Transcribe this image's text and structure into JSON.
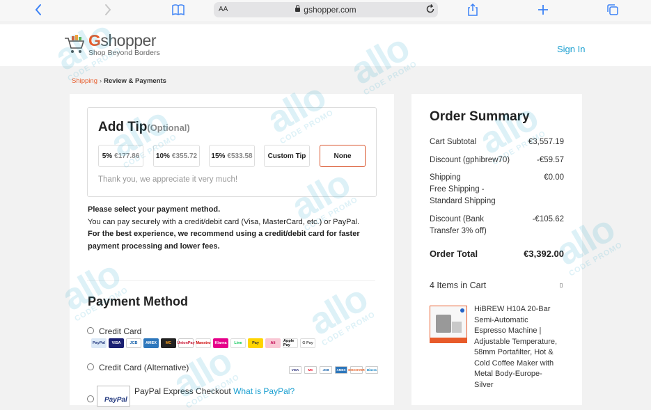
{
  "browser": {
    "text_size_label": "AA",
    "url": "gshopper.com",
    "back_icon": "chevron-left-icon",
    "forward_icon": "chevron-right-icon",
    "bookmarks_icon": "book-icon",
    "share_icon": "share-icon",
    "new_tab_icon": "plus-icon",
    "tabs_icon": "tabs-icon",
    "accent": "#3c82f6"
  },
  "header": {
    "brand": "Gshopper",
    "tagline": "Shop Beyond Borders",
    "sign_in": "Sign In",
    "brand_color": "#e85b2a",
    "link_color": "#1a9fd0"
  },
  "breadcrumb": {
    "step1": "Shipping",
    "separator": "›",
    "step2": "Review & Payments"
  },
  "tip": {
    "title": "Add Tip",
    "optional": "(Optional)",
    "options": [
      {
        "pct": "5%",
        "amount": "€177.86"
      },
      {
        "pct": "10%",
        "amount": "€355.72"
      },
      {
        "pct": "15%",
        "amount": "€533.58"
      },
      {
        "pct": "Custom Tip",
        "amount": ""
      },
      {
        "pct": "None",
        "amount": ""
      }
    ],
    "selected": "None",
    "thanks": "Thank you, we appreciate it very much!"
  },
  "payment_info": {
    "heading": "Please select your payment method.",
    "line": "You can pay securely with a credit/debit card (Visa, MasterCard, etc.) or PayPal.",
    "recommend": "For the best experience, we recommend using a credit/debit card for faster payment processing and lower fees."
  },
  "payment_method": {
    "title": "Payment Method",
    "options": [
      {
        "label": "Credit Card"
      },
      {
        "label": "Credit Card (Alternative)"
      },
      {
        "label": "PayPal Express Checkout",
        "link": "What is PayPal?"
      }
    ],
    "card_logos": [
      "PayPal",
      "VISA",
      "JCB",
      "AMEX",
      "MC",
      "UnionPay",
      "Maestro",
      "Klarna",
      "Line",
      "Pay",
      "Ali",
      "Apple Pay",
      "G Pay"
    ],
    "alt_card_logos": [
      "VISA",
      "MC",
      "JCB",
      "AMEX",
      "DISCOVER",
      "Diners"
    ],
    "paypal_logo": "PayPal"
  },
  "order_summary": {
    "title": "Order Summary",
    "rows": [
      {
        "label": "Cart Subtotal",
        "value": "€3,557.19"
      },
      {
        "label": "Discount (gphibrew70)",
        "value": "-€59.57"
      },
      {
        "label": "Shipping",
        "sub": "Free Shipping - Standard Shipping",
        "value": "€0.00"
      },
      {
        "label": "Discount (Bank Transfer 3% off)",
        "value": "-€105.62"
      }
    ],
    "total_label": "Order Total",
    "total_value": "€3,392.00",
    "items_in_cart": "4 Items in Cart",
    "product": {
      "name": "HiBREW H10A 20-Bar Semi-Automatic Espresso Machine | Adjustable Temperature, 58mm Portafilter, Hot & Cold Coffee Maker with Metal Body-Europe-Silver"
    }
  }
}
